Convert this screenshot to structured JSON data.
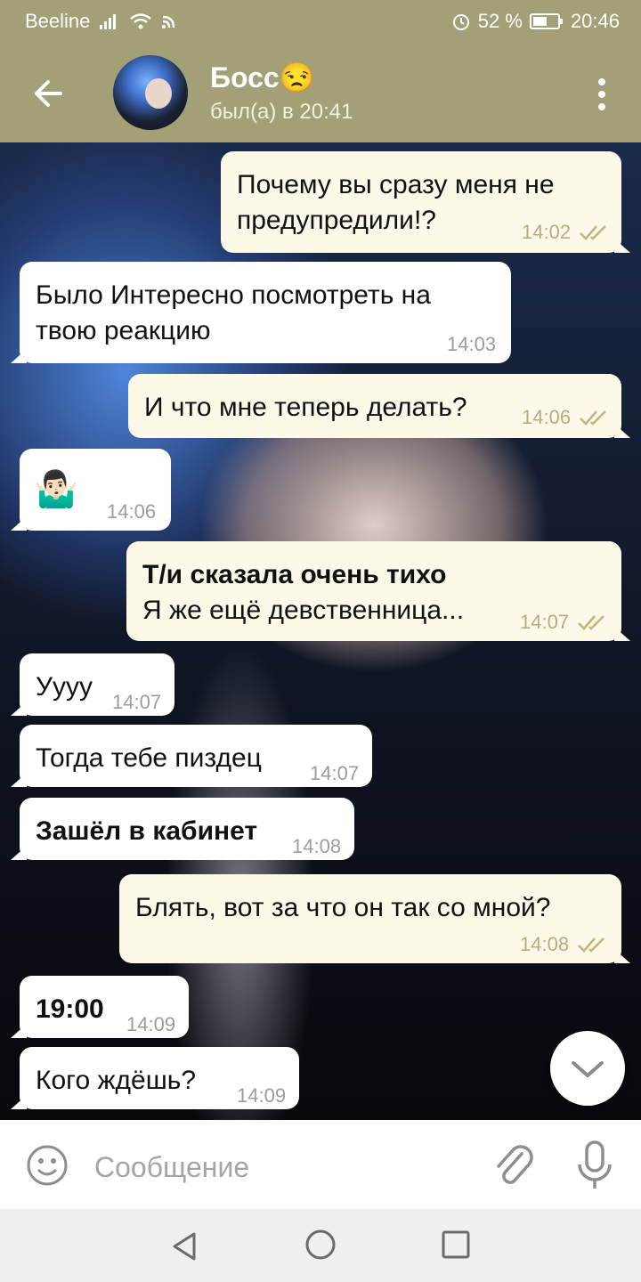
{
  "status_bar": {
    "carrier": "Beeline",
    "battery": "52 %",
    "time": "20:46",
    "icons": [
      "signal-icon",
      "wifi-icon",
      "data-icon",
      "alarm-icon",
      "battery-icon"
    ]
  },
  "header": {
    "contact_name": "Босс😒",
    "last_seen": "был(а) в 20:41",
    "icons": [
      "back-arrow-icon",
      "avatar",
      "more-vertical-icon"
    ]
  },
  "messages": [
    {
      "dir": "out",
      "line1": "Почему вы сразу меня не",
      "line2": "предупредили!?",
      "time": "14:02"
    },
    {
      "dir": "in",
      "line1": "Было Интересно посмотреть на",
      "line2": "твою реакцию",
      "time": "14:03"
    },
    {
      "dir": "out",
      "text": "И что мне теперь делать?",
      "time": "14:06"
    },
    {
      "dir": "in",
      "emoji": "🤷🏻‍♂️",
      "time": "14:06"
    },
    {
      "dir": "out",
      "bold": "Т/и сказала очень тихо",
      "text": "Я же ещё девственница...",
      "time": "14:07"
    },
    {
      "dir": "in",
      "text": "Уууу",
      "time": "14:07"
    },
    {
      "dir": "in",
      "text": "Тогда тебе пиздец",
      "time": "14:07"
    },
    {
      "dir": "in",
      "bold": "Зашёл в кабинет",
      "time": "14:08"
    },
    {
      "dir": "out",
      "text": "Блять, вот за что он так со мной?",
      "time": "14:08"
    },
    {
      "dir": "in",
      "bold": "19:00",
      "time": "14:09"
    },
    {
      "dir": "in",
      "text": "Кого ждёшь?",
      "time": "14:09"
    }
  ],
  "input": {
    "placeholder": "Сообщение"
  },
  "colors": {
    "header": "#a39f76",
    "incoming": "#ffffff",
    "outgoing": "#fdf9e9",
    "check": "#c4b47a"
  }
}
